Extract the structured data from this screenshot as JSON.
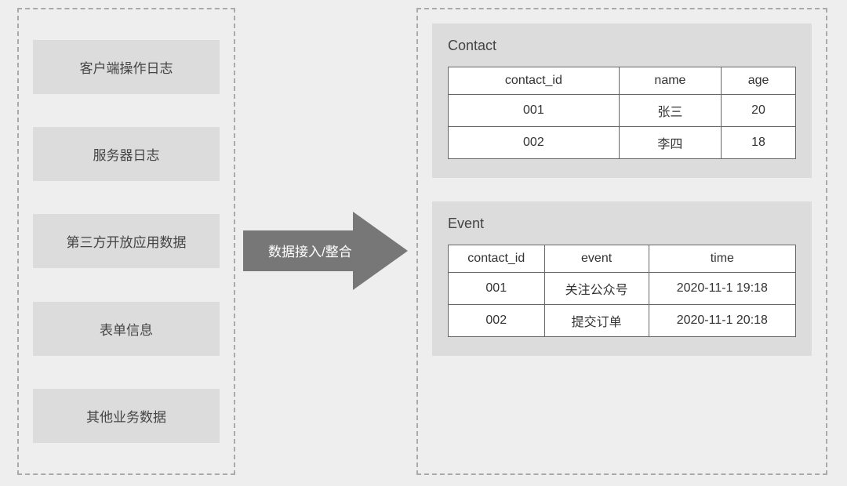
{
  "sources": [
    "客户端操作日志",
    "服务器日志",
    "第三方开放应用数据",
    "表单信息",
    "其他业务数据"
  ],
  "arrow_label": "数据接入/整合",
  "contact_card": {
    "title": "Contact",
    "headers": [
      "contact_id",
      "name",
      "age"
    ],
    "rows": [
      [
        "001",
        "张三",
        "20"
      ],
      [
        "002",
        "李四",
        "18"
      ]
    ]
  },
  "event_card": {
    "title": "Event",
    "headers": [
      "contact_id",
      "event",
      "time"
    ],
    "rows": [
      [
        "001",
        "关注公众号",
        "2020-11-1 19:18"
      ],
      [
        "002",
        "提交订单",
        "2020-11-1 20:18"
      ]
    ]
  }
}
